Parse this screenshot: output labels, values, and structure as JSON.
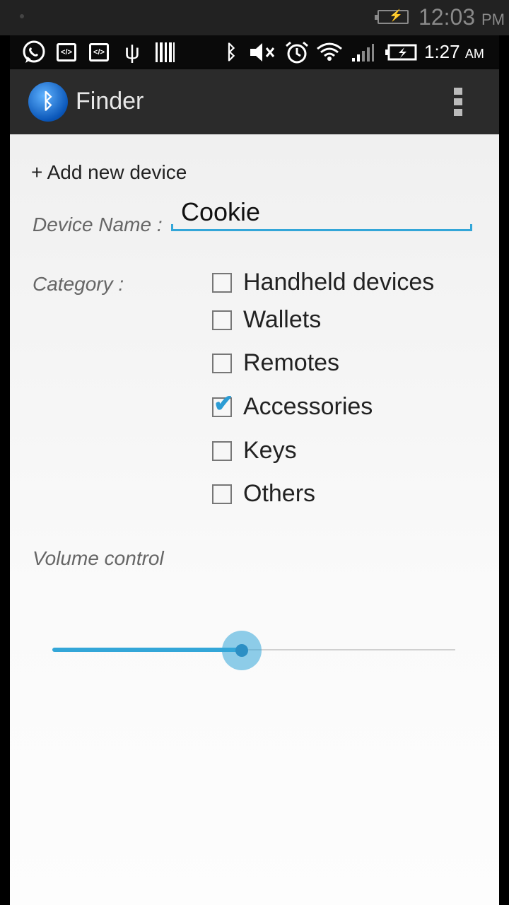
{
  "outer_status": {
    "time": "12:03",
    "ampm": "PM"
  },
  "status_bar": {
    "time": "1:27",
    "ampm": "AM"
  },
  "app": {
    "title": "Finder"
  },
  "form": {
    "add_new_device": "+ Add new device",
    "device_name_label": "Device Name :",
    "device_name_value": "Cookie",
    "category_label": "Category :",
    "categories": [
      {
        "label": "Handheld devices",
        "checked": false
      },
      {
        "label": "Wallets",
        "checked": false
      },
      {
        "label": "Remotes",
        "checked": false
      },
      {
        "label": "Accessories",
        "checked": true
      },
      {
        "label": "Keys",
        "checked": false
      },
      {
        "label": "Others",
        "checked": false
      }
    ],
    "volume_label": "Volume control",
    "volume_value": 0.47
  },
  "colors": {
    "accent": "#33a6d8",
    "action_bar": "#2b2b2b"
  }
}
